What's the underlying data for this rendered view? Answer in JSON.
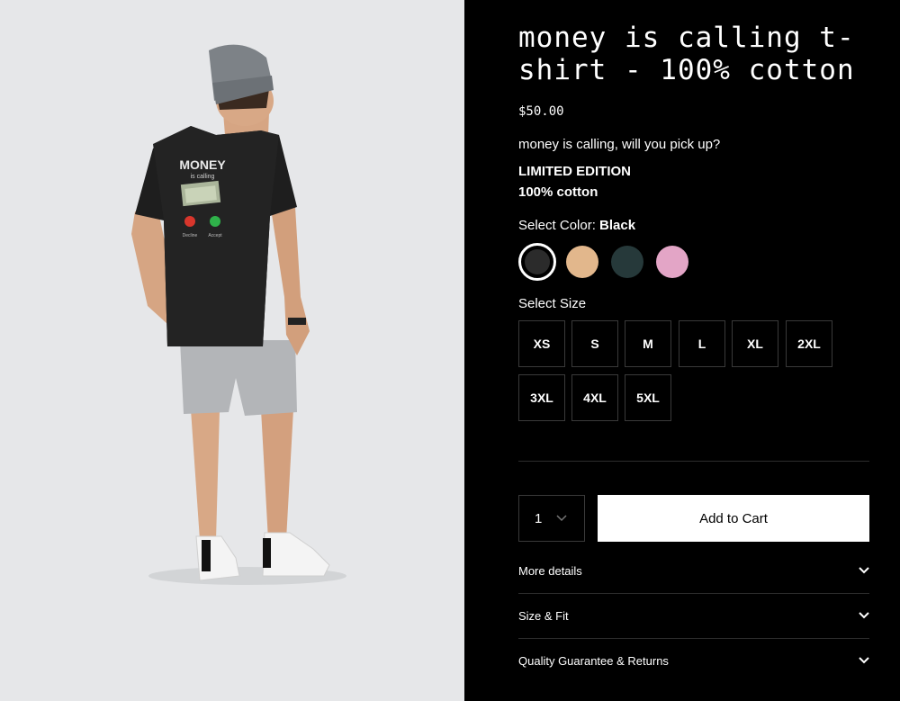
{
  "product": {
    "title": "money is calling t-shirt - 100% cotton",
    "price": "$50.00",
    "tagline": "money is calling, will you pick up?",
    "features": [
      "LIMITED EDITION",
      "100% cotton"
    ]
  },
  "image": {
    "print_headline": "MONEY",
    "print_subline": "is calling",
    "decline_label": "Decline",
    "accept_label": "Accept"
  },
  "color": {
    "label": "Select Color:",
    "selected": "Black",
    "swatches": [
      {
        "name": "Black",
        "hex": "#2b2b2b"
      },
      {
        "name": "Tan",
        "hex": "#e2b78c"
      },
      {
        "name": "Dark Green",
        "hex": "#26393a"
      },
      {
        "name": "Pink",
        "hex": "#e3a5c6"
      }
    ]
  },
  "size": {
    "label": "Select Size",
    "options": [
      "XS",
      "S",
      "M",
      "L",
      "XL",
      "2XL",
      "3XL",
      "4XL",
      "5XL"
    ]
  },
  "cart": {
    "quantity": "1",
    "add_label": "Add to Cart"
  },
  "accordions": [
    {
      "label": "More details"
    },
    {
      "label": "Size & Fit"
    },
    {
      "label": "Quality Guarantee & Returns"
    }
  ]
}
